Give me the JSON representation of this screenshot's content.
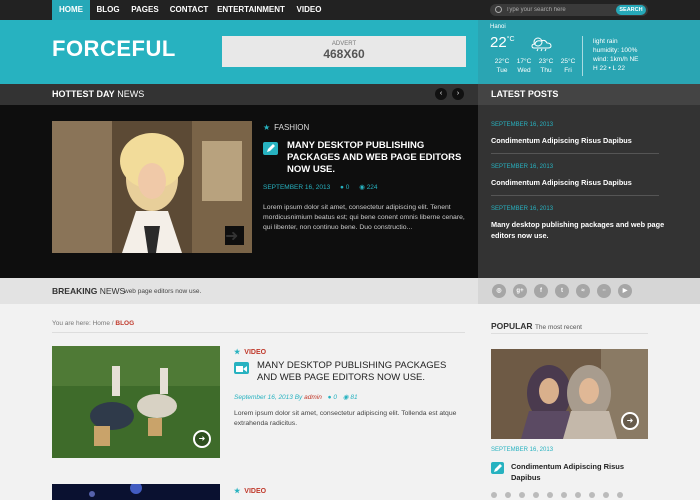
{
  "nav": {
    "items": [
      {
        "label": "HOME",
        "active": true
      },
      {
        "label": "BLOG"
      },
      {
        "label": "PAGES"
      },
      {
        "label": "CONTACT"
      },
      {
        "label": "ENTERTAINMENT"
      },
      {
        "label": "VIDEO"
      }
    ],
    "search": {
      "placeholder": "Type your search here",
      "button": "SEARCH"
    }
  },
  "header": {
    "logo": "FORCEFUL",
    "advert_label": "ADVERT",
    "advert_size": "468X60"
  },
  "weather": {
    "city": "Hanoi",
    "temp": "22",
    "unit": "C",
    "condition": "light rain",
    "humidity": "humidity: 100%",
    "wind": "wind: 1km/h NE",
    "hl": "H 22 • L 22",
    "forecast": [
      {
        "temp": "22°C",
        "day": "Tue"
      },
      {
        "temp": "17°C",
        "day": "Wed"
      },
      {
        "temp": "23°C",
        "day": "Thu"
      },
      {
        "temp": "25°C",
        "day": "Fri"
      }
    ]
  },
  "hottest": {
    "title_bold": "HOTTEST DAY",
    "title_rest": "NEWS",
    "category": "FASHION",
    "headline": "MANY DESKTOP PUBLISHING PACKAGES AND WEB PAGE EDITORS NOW USE.",
    "date": "SEPTEMBER 16, 2013",
    "comments": "0",
    "views": "224",
    "excerpt": "Lorem ipsum dolor sit amet, consectetur adipiscing elit. Tenent mordicusnimium beatus est; qui bene conent omnis liberne cenare, qui libenter, non continuo bene. Duo constructio..."
  },
  "latest": {
    "title": "LATEST POSTS",
    "posts": [
      {
        "date": "SEPTEMBER 16, 2013",
        "title": "Condimentum Adipiscing Risus Dapibus"
      },
      {
        "date": "SEPTEMBER 16, 2013",
        "title": "Condimentum Adipiscing Risus Dapibus"
      },
      {
        "date": "SEPTEMBER 16, 2013",
        "title": "Many desktop publishing packages and web page editors now use."
      }
    ]
  },
  "breaking": {
    "label_bold": "BREAKING",
    "label_rest": "NEWS",
    "text": "web page editors now use."
  },
  "social": {
    "icons": [
      "dribbble-icon",
      "google-plus-icon",
      "facebook-icon",
      "twitter-icon",
      "rss-icon",
      "flickr-icon",
      "youtube-icon"
    ]
  },
  "breadcrumb": {
    "prefix": "You are here:",
    "home": "Home",
    "sep": "/",
    "current": "BLOG"
  },
  "blog_post": {
    "category": "VIDEO",
    "headline": "MANY DESKTOP PUBLISHING PACKAGES AND WEB PAGE EDITORS NOW USE.",
    "date": "September 16, 2013",
    "by": "By",
    "author": "admin",
    "comments": "0",
    "views": "81",
    "excerpt": "Lorem ipsum dolor sit amet, consectetur adipiscing elit. Tollenda est atque extrahenda radicitus."
  },
  "blog_post2": {
    "category": "VIDEO"
  },
  "popular": {
    "title_bold": "POPULAR",
    "title_rest": "The most recent",
    "date": "SEPTEMBER 16, 2013",
    "title": "Condimentum Adipiscing Risus Dapibus"
  },
  "colors": {
    "accent": "#27b2c0",
    "dark": "#0e0e0e",
    "red": "#c0392b"
  }
}
